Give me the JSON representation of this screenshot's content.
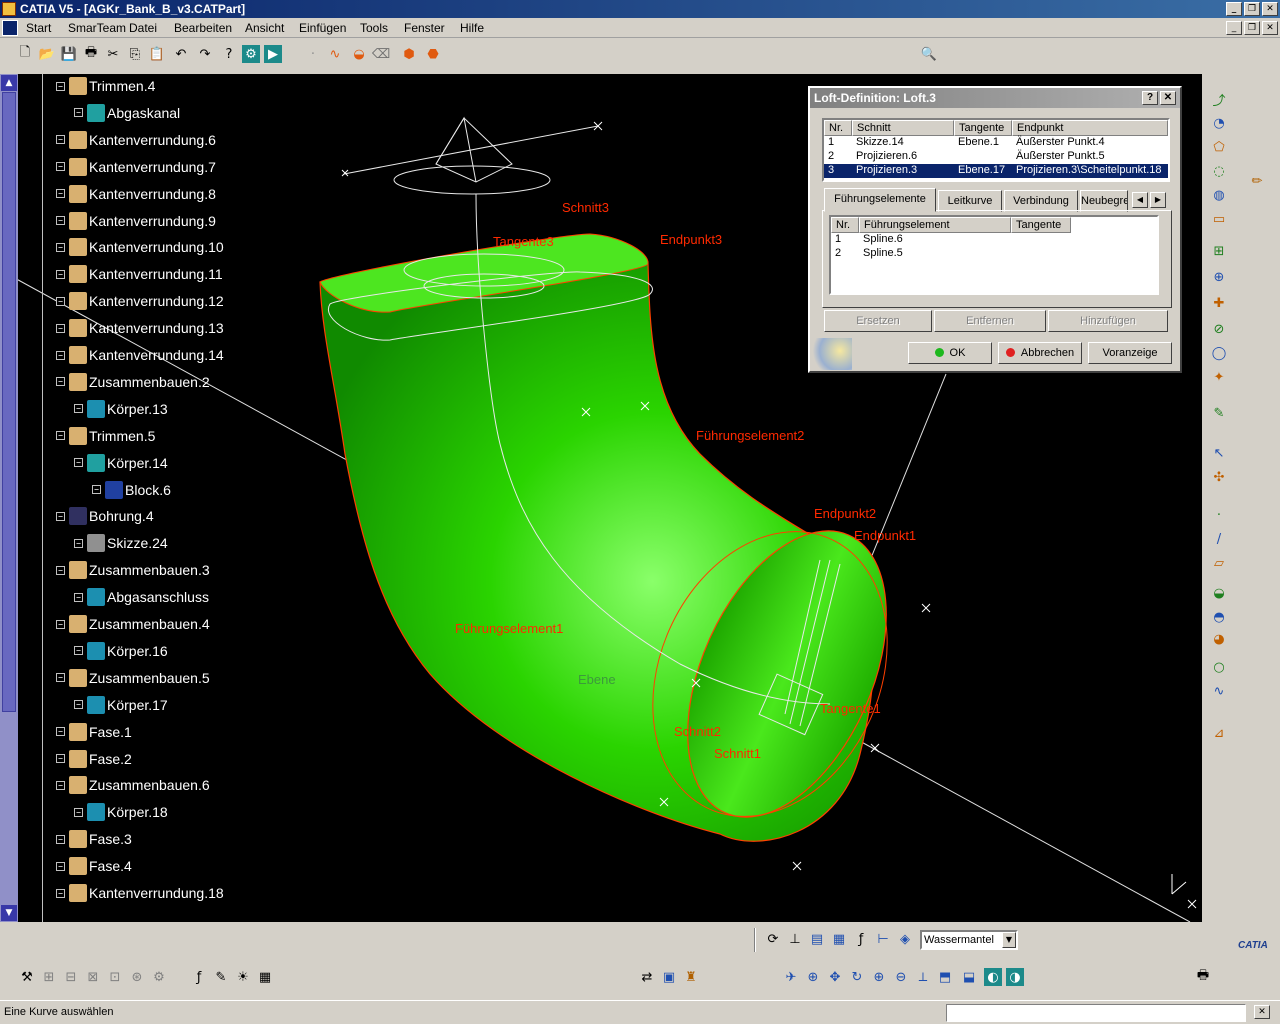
{
  "window": {
    "title": "CATIA V5 - [AGKr_Bank_B_v3.CATPart]",
    "minimize": "_",
    "restore": "❐",
    "close": "✕"
  },
  "menu": {
    "items": [
      "Start",
      "SmarTeam",
      "Datei",
      "Bearbeiten",
      "Ansicht",
      "Einfügen",
      "Tools",
      "Fenster",
      "Hilfe"
    ]
  },
  "tree": {
    "nodes": [
      {
        "label": "Trimmen.4",
        "icon": "trim-icon"
      },
      {
        "label": "Abgaskanal",
        "icon": "gear-body-icon"
      },
      {
        "label": "Kantenverrundung.6",
        "icon": "fillet-icon"
      },
      {
        "label": "Kantenverrundung.7",
        "icon": "fillet-icon"
      },
      {
        "label": "Kantenverrundung.8",
        "icon": "fillet-icon"
      },
      {
        "label": "Kantenverrundung.9",
        "icon": "fillet-icon"
      },
      {
        "label": "Kantenverrundung.10",
        "icon": "fillet-icon"
      },
      {
        "label": "Kantenverrundung.11",
        "icon": "fillet-icon"
      },
      {
        "label": "Kantenverrundung.12",
        "icon": "fillet-icon"
      },
      {
        "label": "Kantenverrundung.13",
        "icon": "fillet-icon"
      },
      {
        "label": "Kantenverrundung.14",
        "icon": "fillet-icon"
      },
      {
        "label": "Zusammenbauen.2",
        "icon": "assemble-icon"
      },
      {
        "label": "Körper.13",
        "icon": "body-icon"
      },
      {
        "label": "Trimmen.5",
        "icon": "trim-icon"
      },
      {
        "label": "Körper.14",
        "icon": "gear-body-icon"
      },
      {
        "label": "Block.6",
        "icon": "pad-icon"
      },
      {
        "label": "Bohrung.4",
        "icon": "hole-icon"
      },
      {
        "label": "Skizze.24",
        "icon": "sketch-icon"
      },
      {
        "label": "Zusammenbauen.3",
        "icon": "assemble-icon"
      },
      {
        "label": "Abgasanschluss",
        "icon": "body-icon"
      },
      {
        "label": "Zusammenbauen.4",
        "icon": "assemble-icon"
      },
      {
        "label": "Körper.16",
        "icon": "body-icon"
      },
      {
        "label": "Zusammenbauen.5",
        "icon": "assemble-icon"
      },
      {
        "label": "Körper.17",
        "icon": "body-icon"
      },
      {
        "label": "Fase.1",
        "icon": "chamfer-icon"
      },
      {
        "label": "Fase.2",
        "icon": "chamfer-icon"
      },
      {
        "label": "Zusammenbauen.6",
        "icon": "assemble-icon"
      },
      {
        "label": "Körper.18",
        "icon": "body-icon"
      },
      {
        "label": "Fase.3",
        "icon": "chamfer-icon"
      },
      {
        "label": "Fase.4",
        "icon": "chamfer-icon"
      },
      {
        "label": "Kantenverrundung.18",
        "icon": "fillet-icon"
      }
    ]
  },
  "scene_labels": {
    "schnitt3": "Schnitt3",
    "tangente3": "Tangente3",
    "endpunkt3": "Endpunkt3",
    "fuehrung2": "Führungselement2",
    "endpunkt2": "Endpunkt2",
    "endpunkt1": "Endpunkt1",
    "fuehrung1": "Führungselement1",
    "tangente1": "Tangente1",
    "schnitt2": "Schnitt2",
    "schnitt1": "Schnitt1",
    "ebene": "Ebene"
  },
  "dialog": {
    "title": "Loft-Definition: Loft.3",
    "help": "?",
    "close": "✕",
    "sections_columns": [
      "Nr.",
      "Schnitt",
      "Tangente",
      "Endpunkt"
    ],
    "sections_rows": [
      [
        "1",
        "Skizze.14",
        "Ebene.1",
        "Äußerster Punkt.4"
      ],
      [
        "2",
        "Projizieren.6",
        "",
        "Äußerster Punkt.5"
      ],
      [
        "3",
        "Projizieren.3",
        "Ebene.17",
        "Projizieren.3\\Scheitelpunkt.18"
      ]
    ],
    "tabs": [
      "Führungselemente",
      "Leitkurve",
      "Verbindung",
      "Neubegre"
    ],
    "guides_columns": [
      "Nr.",
      "Führungselement",
      "Tangente"
    ],
    "guides_rows": [
      [
        "1",
        "Spline.6",
        ""
      ],
      [
        "2",
        "Spline.5",
        ""
      ]
    ],
    "btn_replace": "Ersetzen",
    "btn_remove": "Entfernen",
    "btn_add": "Hinzufügen",
    "btn_ok": "OK",
    "btn_cancel": "Abbrechen",
    "btn_preview": "Voranzeige"
  },
  "bottom": {
    "select_value": "Wassermantel",
    "catia_logo": "CATIA"
  },
  "status": {
    "text": "Eine Kurve auswählen"
  },
  "colors": {
    "part_green": "#22cc00",
    "annotation_red": "#ff2a00",
    "selection_blue": "#0a246a"
  }
}
